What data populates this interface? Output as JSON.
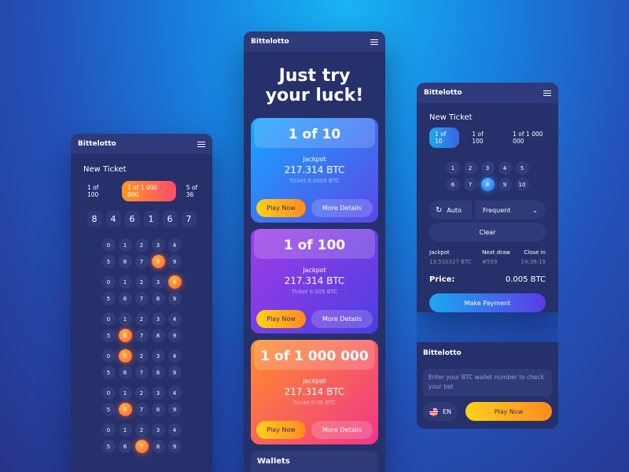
{
  "left": {
    "brand": "Bittelotto",
    "title": "New Ticket",
    "tabs": [
      "1 of 100",
      "1 of 1 000 000",
      "5 of 36"
    ],
    "active_tab": 1,
    "digits": [
      "8",
      "4",
      "6",
      "1",
      "6",
      "7"
    ],
    "groups": [
      {
        "rows": [
          [
            "0",
            "1",
            "2",
            "3",
            "4"
          ],
          [
            "5",
            "6",
            "7",
            "8",
            "9"
          ]
        ],
        "hit": "8"
      },
      {
        "rows": [
          [
            "0",
            "1",
            "2",
            "3",
            "4"
          ],
          [
            "5",
            "6",
            "7",
            "8",
            "9"
          ]
        ],
        "hit": "4"
      },
      {
        "rows": [
          [
            "0",
            "1",
            "2",
            "3",
            "4"
          ],
          [
            "5",
            "6",
            "7",
            "8",
            "9"
          ]
        ],
        "hit": "6"
      },
      {
        "rows": [
          [
            "0",
            "1",
            "2",
            "3",
            "4"
          ],
          [
            "5",
            "6",
            "7",
            "8",
            "9"
          ]
        ],
        "hit": "1"
      },
      {
        "rows": [
          [
            "0",
            "1",
            "2",
            "3",
            "4"
          ],
          [
            "5",
            "6",
            "7",
            "8",
            "9"
          ]
        ],
        "hit": "6"
      },
      {
        "rows": [
          [
            "0",
            "1",
            "2",
            "3",
            "4"
          ],
          [
            "5",
            "6",
            "7",
            "8",
            "9"
          ]
        ],
        "hit": "7"
      }
    ]
  },
  "middle": {
    "brand": "Bittelotto",
    "hero": [
      "Just try",
      "your luck!"
    ],
    "cards": [
      {
        "title": "1 of 10",
        "jackpot_label": "Jackpot",
        "jackpot": "217.314 BTC",
        "ticket": "Ticket 0.0005 BTC",
        "play": "Play Now",
        "more": "More Details",
        "gradient": [
          "#17a6ff",
          "#5b49e8"
        ]
      },
      {
        "title": "1 of 100",
        "jackpot_label": "Jackpot",
        "jackpot": "217.314 BTC",
        "ticket": "Ticket 0.005 BTC",
        "play": "Play Now",
        "more": "More Details",
        "gradient": [
          "#a23ce6",
          "#4b3ee0"
        ]
      },
      {
        "title": "1 of 1 000 000",
        "jackpot_label": "Jackpot",
        "jackpot": "217.314 BTC",
        "ticket": "Ticket 0.05 BTC",
        "play": "Play Now",
        "more": "More Details",
        "gradient": [
          "#ff8f2a",
          "#f0368a"
        ]
      }
    ],
    "wallets": "Wallets"
  },
  "right": {
    "brand": "Bittelotto",
    "title": "New Ticket",
    "tabs": [
      "1 of 10",
      "1 of 100",
      "1 of 1 000 000"
    ],
    "active_tab": 0,
    "rows": [
      [
        "1",
        "2",
        "3",
        "4",
        "5"
      ],
      [
        "6",
        "7",
        "8",
        "9",
        "10"
      ]
    ],
    "selected": "8",
    "auto": "Auto",
    "frequency": "Frequent",
    "clear": "Clear",
    "info": [
      {
        "label": "Jackpot",
        "value": "13.510327 BTC"
      },
      {
        "label": "Next draw",
        "value": "#559"
      },
      {
        "label": "Close in",
        "value": "19:39:19"
      }
    ],
    "price_label": "Price:",
    "price_value": "0.005 BTC",
    "payment": "Make Payment",
    "footer_brand": "Bittelotto",
    "wallet_placeholder": "Enter your BTC wallet number to check your bet",
    "lang": "EN",
    "play": "Play Now"
  }
}
